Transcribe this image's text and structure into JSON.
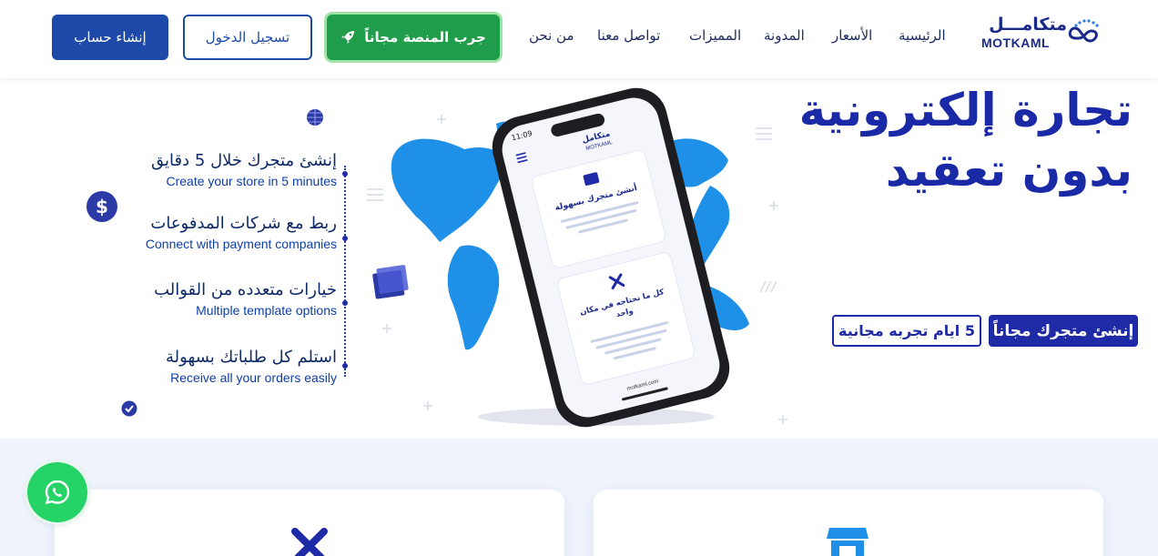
{
  "header": {
    "logo_ar": "متكامـــل",
    "logo_en": "MOTKAML",
    "nav": [
      "الرئيسية",
      "الأسعار",
      "المدونة",
      "المميزات",
      "تواصل معنا",
      "من نحن"
    ],
    "try_button": "جرب المنصة مجاناً",
    "login_button": "تسجيل الدخول",
    "signup_button": "إنشاء حساب"
  },
  "hero": {
    "headline_line1": "تجارة إلكترونية",
    "headline_line2": "بدون تعقيد",
    "cta_primary": "إنشئ متجرك مجاناً",
    "cta_secondary": "5 ايام تجربه مجانية",
    "features": [
      {
        "ar": "إنشئ متجرك خلال 5 دقايق",
        "en": "Create your store in 5 minutes"
      },
      {
        "ar": "ربط مع شركات المدفوعات",
        "en": "Connect with payment companies"
      },
      {
        "ar": "خيارات متعدده من القوالب",
        "en": "Multiple template options"
      },
      {
        "ar": "استلم كل طلباتك بسهولة",
        "en": "Receive all your orders easily"
      }
    ],
    "phone": {
      "time": "11:09",
      "brand": "متكامل",
      "brand_en": "MOTKAML",
      "card1_title": "أنشئ متجرك بسهولة",
      "card2_title_1": "كل ما تحتاجه في مكان",
      "card2_title_2": "واحد",
      "url": "motkaml.com"
    }
  },
  "colors": {
    "brand_blue": "#1f2aa6",
    "green": "#1f9d4a",
    "map_blue": "#1e90e8",
    "whatsapp": "#25d366"
  },
  "icons": [
    "rocket-icon",
    "whatsapp-icon",
    "dollar-icon",
    "check-icon",
    "globe-icon",
    "tools-icon",
    "store-icon",
    "hamburger-menu-icon"
  ]
}
